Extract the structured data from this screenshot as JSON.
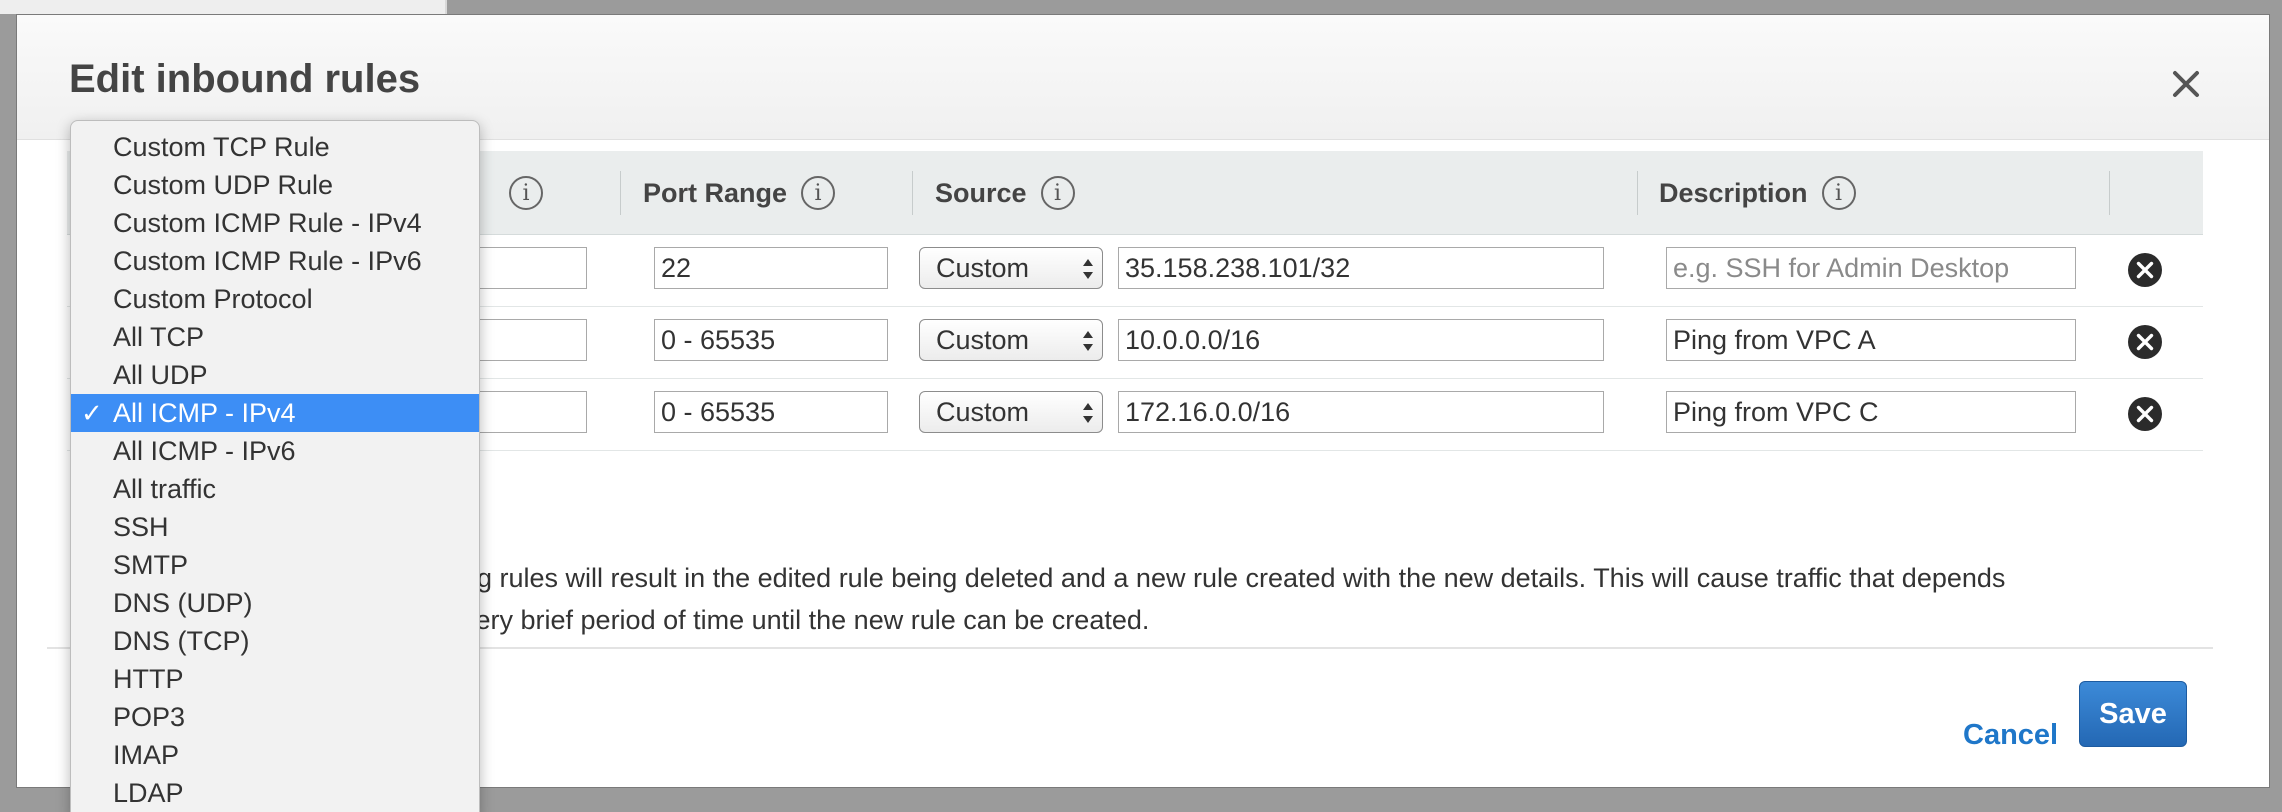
{
  "modal": {
    "title": "Edit inbound rules",
    "close_icon": "close-icon"
  },
  "table": {
    "headers": {
      "port_range": "Port Range",
      "source": "Source",
      "description": "Description"
    },
    "rows": [
      {
        "port_range": "22",
        "source_type": "Custom",
        "source_value": "35.158.238.101/32",
        "description": "",
        "description_placeholder": "e.g. SSH for Admin Desktop"
      },
      {
        "port_range": "0 - 65535",
        "source_type": "Custom",
        "source_value": "10.0.0.0/16",
        "description": "Ping from VPC A",
        "description_placeholder": ""
      },
      {
        "port_range": "0 - 65535",
        "source_type": "Custom",
        "source_value": "172.16.0.0/16",
        "description": "Ping from VPC C",
        "description_placeholder": ""
      }
    ]
  },
  "note": {
    "line1": "ng rules will result in the edited rule being deleted and a new rule created with the new details. This will cause traffic that depends",
    "line2": "very brief period of time until the new rule can be created."
  },
  "footer": {
    "cancel_label": "Cancel",
    "save_label": "Save"
  },
  "dropdown": {
    "selected": "All ICMP - IPv4",
    "check_mark": "✓",
    "items": [
      "Custom TCP Rule",
      "Custom UDP Rule",
      "Custom ICMP Rule - IPv4",
      "Custom ICMP Rule - IPv6",
      "Custom Protocol",
      "All TCP",
      "All UDP",
      "All ICMP - IPv4",
      "All ICMP - IPv6",
      "All traffic",
      "SSH",
      "SMTP",
      "DNS (UDP)",
      "DNS (TCP)",
      "HTTP",
      "POP3",
      "IMAP",
      "LDAP"
    ]
  },
  "colors": {
    "accent": "#3d8ef5",
    "save_button": "#2f7bc8",
    "cancel_link": "#1f77c9"
  }
}
